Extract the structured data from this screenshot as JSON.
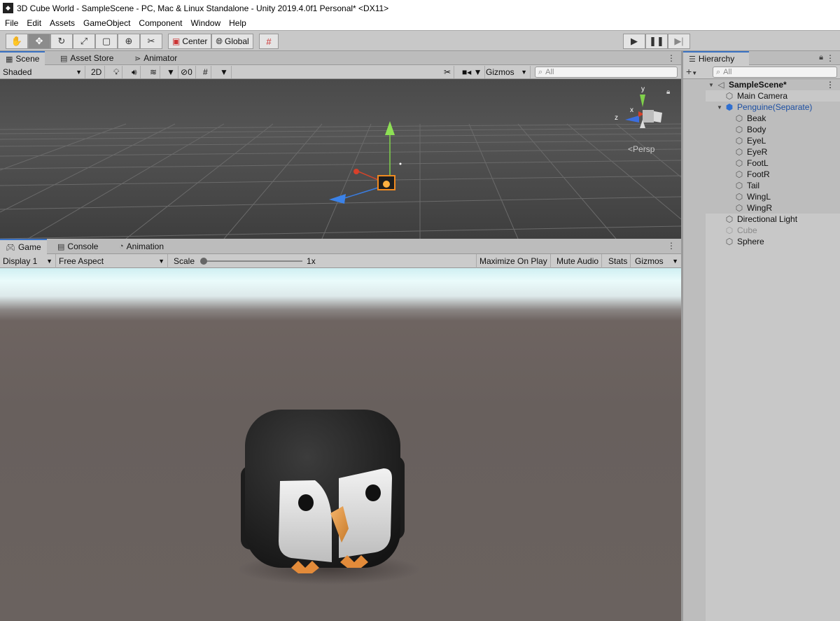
{
  "window": {
    "title": "3D Cube World - SampleScene - PC, Mac & Linux Standalone - Unity 2019.4.0f1 Personal* <DX11>"
  },
  "menu": [
    "File",
    "Edit",
    "Assets",
    "GameObject",
    "Component",
    "Window",
    "Help"
  ],
  "toolbar": {
    "tools": [
      "hand-icon",
      "move-icon",
      "rotate-icon",
      "scale-icon",
      "rect-icon",
      "transform-icon",
      "custom-tool-icon"
    ],
    "active_tool": "move-icon",
    "pivot_label": "Center",
    "space_label": "Global",
    "snap_icon": "grid-snap-icon",
    "play_icons": [
      "play-icon",
      "pause-icon",
      "step-icon"
    ]
  },
  "scene_panel": {
    "tabs": [
      {
        "label": "Scene",
        "icon": "scene-icon"
      },
      {
        "label": "Asset Store",
        "icon": "store-icon"
      },
      {
        "label": "Animator",
        "icon": "animator-icon"
      }
    ],
    "active_tab": "Scene",
    "draw_mode": "Shaded",
    "mode_2d": "2D",
    "hidden_count": "0",
    "gizmos_label": "Gizmos",
    "search_placeholder": "All",
    "persp_label": "Persp",
    "gizmo_axes": {
      "y": "y",
      "x": "x",
      "z": "z"
    }
  },
  "game_panel": {
    "tabs": [
      {
        "label": "Game",
        "icon": "game-icon"
      },
      {
        "label": "Console",
        "icon": "console-icon"
      },
      {
        "label": "Animation",
        "icon": "animation-icon"
      }
    ],
    "active_tab": "Game",
    "display": "Display 1",
    "aspect": "Free Aspect",
    "scale_label": "Scale",
    "scale_value": "1x",
    "maximize_label": "Maximize On Play",
    "mute_label": "Mute Audio",
    "stats_label": "Stats",
    "gizmos_label": "Gizmos"
  },
  "hierarchy": {
    "tab_label": "Hierarchy",
    "search_placeholder": "All",
    "scene_name": "SampleScene*",
    "items": [
      {
        "label": "Main Camera",
        "depth": 1,
        "state": "normal"
      },
      {
        "label": "Penguine(Separate)",
        "depth": 1,
        "state": "prefab",
        "expanded": true
      },
      {
        "label": "Beak",
        "depth": 2,
        "state": "normal"
      },
      {
        "label": "Body",
        "depth": 2,
        "state": "normal"
      },
      {
        "label": "EyeL",
        "depth": 2,
        "state": "normal"
      },
      {
        "label": "EyeR",
        "depth": 2,
        "state": "normal"
      },
      {
        "label": "FootL",
        "depth": 2,
        "state": "normal"
      },
      {
        "label": "FootR",
        "depth": 2,
        "state": "normal"
      },
      {
        "label": "Tail",
        "depth": 2,
        "state": "normal"
      },
      {
        "label": "WingL",
        "depth": 2,
        "state": "normal"
      },
      {
        "label": "WingR",
        "depth": 2,
        "state": "normal"
      },
      {
        "label": "Directional Light",
        "depth": 1,
        "state": "normal"
      },
      {
        "label": "Cube",
        "depth": 1,
        "state": "disabled"
      },
      {
        "label": "Sphere",
        "depth": 1,
        "state": "normal"
      }
    ]
  }
}
